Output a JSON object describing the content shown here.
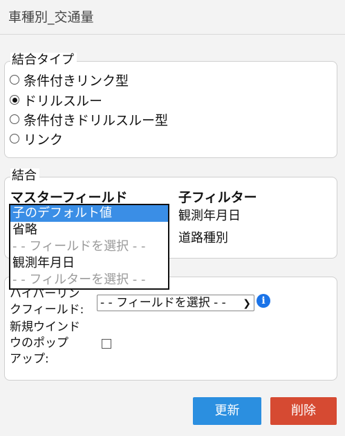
{
  "title": "車種別_交通量",
  "join_type": {
    "legend": "結合タイプ",
    "options": [
      {
        "label": "条件付きリンク型",
        "selected": false
      },
      {
        "label": "ドリルスルー",
        "selected": true
      },
      {
        "label": "条件付きドリルスルー型",
        "selected": false
      },
      {
        "label": "リンク",
        "selected": false
      }
    ]
  },
  "join": {
    "legend": "結合",
    "master_header": "マスターフィールド",
    "child_header": "子フィルター",
    "child_rows": [
      "観測年月日",
      "道路種別"
    ],
    "dropdown_options": [
      {
        "label": "子のデフォルト値",
        "state": "selected"
      },
      {
        "label": "省略",
        "state": "normal"
      },
      {
        "label": "- - フィールドを選択 - -",
        "state": "dim"
      },
      {
        "label": "観測年月日",
        "state": "normal"
      },
      {
        "label": "- - フィルターを選択 - -",
        "state": "dim"
      }
    ]
  },
  "options": {
    "hyperlink_label_1": "ハイパーリン",
    "hyperlink_label_2": "クフィールド:",
    "hyperlink_select_value": "- - フィールドを選択 - -",
    "info_icon": "i",
    "popup_label_1": "新規ウインド",
    "popup_label_2": "ウのポップ",
    "popup_label_3": "アップ:",
    "popup_checked": false
  },
  "buttons": {
    "update": "更新",
    "delete": "削除"
  },
  "colors": {
    "update": "#2b8fe0",
    "delete": "#d64a32",
    "selection": "#3a8ee6"
  }
}
